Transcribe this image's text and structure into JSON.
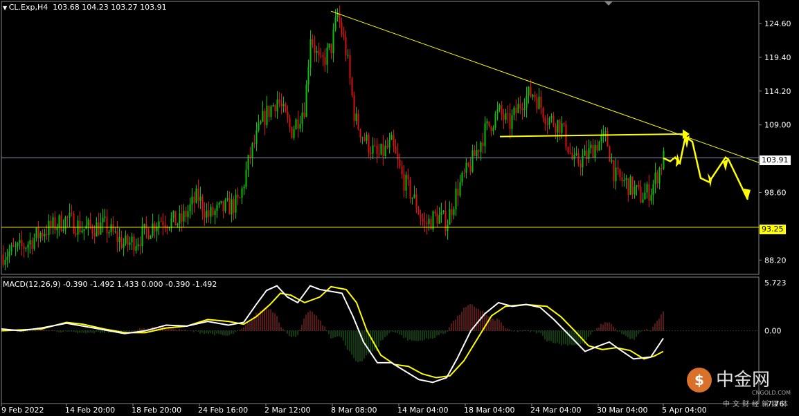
{
  "header": {
    "symbol": "CL.Exp,H4",
    "ohlc": "103.68 104.23 103.27 103.91",
    "macd_label": "MACD(12,26,9)",
    "macd_values": "-0.390 -1.492 1.433 0.000 -0.390 -1.492"
  },
  "price_axis": {
    "ticks": [
      "124.60",
      "119.40",
      "114.20",
      "109.00",
      "98.60",
      "88.20"
    ],
    "current_price": "103.91",
    "support_level": "93.25"
  },
  "macd_axis": {
    "ticks": [
      "5.723",
      "0.00",
      "-7.76"
    ]
  },
  "time_axis": {
    "ticks": [
      "9 Feb 2022",
      "14 Feb 20:00",
      "18 Feb 20:00",
      "24 Feb 16:00",
      "2 Mar 12:00",
      "8 Mar 08:00",
      "14 Mar 04:00",
      "18 Mar 04:00",
      "24 Mar 04:00",
      "30 Mar 04:00",
      "5 Apr 04:00"
    ]
  },
  "colors": {
    "background": "#000000",
    "bull": "#00c800",
    "bear": "#e01010",
    "trendline": "#ffff00",
    "macd_main": "#ffffff",
    "macd_signal": "#ffff00",
    "hist_pos": "#b03030",
    "hist_neg": "#1f7a1f",
    "current_price_line": "#8c97b0"
  },
  "watermark": {
    "brand": "中金网",
    "domain": "CNGOLD.COM",
    "tagline": "中文财经新媒体"
  },
  "chart_data": [
    {
      "type": "candlestick",
      "title": "CL.Exp,H4",
      "ylim": [
        86,
        128
      ],
      "current_price": 103.91,
      "horizontal_levels": [
        93.25,
        103.91
      ],
      "close_path_approx": [
        {
          "x": "9 Feb 2022",
          "close": 89.0
        },
        {
          "x": "14 Feb 20:00",
          "close": 94.0
        },
        {
          "x": "18 Feb 20:00",
          "close": 91.5
        },
        {
          "x": "24 Feb 16:00",
          "close": 96.0
        },
        {
          "x": "2 Mar 12:00",
          "close": 112.0
        },
        {
          "x": "8 Mar 08:00",
          "close": 122.0
        },
        {
          "x": "14 Mar 04:00",
          "close": 97.0
        },
        {
          "x": "18 Mar 04:00",
          "close": 105.0
        },
        {
          "x": "24 Mar 04:00",
          "close": 112.5
        },
        {
          "x": "30 Mar 04:00",
          "close": 101.0
        },
        {
          "x": "5 Apr 04:00",
          "close": 103.91
        }
      ],
      "annotations": [
        {
          "kind": "descending_trendline",
          "from": {
            "x": "8 Mar 08:00",
            "price": 126.5
          },
          "to": {
            "x": "5 Apr 04:00",
            "price": 104.0
          }
        },
        {
          "kind": "resistance_level",
          "price": 107.5,
          "from": "18 Mar 04:00",
          "to": "5 Apr 04:00"
        },
        {
          "kind": "support_level",
          "price": 93.25
        },
        {
          "kind": "projected_path",
          "points": [
            103.9,
            103.5,
            107.2,
            100.5,
            103.5,
            97.5
          ]
        }
      ]
    },
    {
      "type": "line",
      "title": "MACD(12,26,9)",
      "ylim": [
        -7.76,
        5.723
      ],
      "series_values_at_ticks": {
        "x": [
          "9 Feb 2022",
          "14 Feb 20:00",
          "18 Feb 20:00",
          "24 Feb 16:00",
          "2 Mar 12:00",
          "8 Mar 08:00",
          "14 Mar 04:00",
          "18 Mar 04:00",
          "24 Mar 04:00",
          "30 Mar 04:00",
          "5 Apr 04:00"
        ],
        "main": [
          0.2,
          0.8,
          0.1,
          0.5,
          3.5,
          4.0,
          -3.5,
          -1.5,
          2.6,
          -1.5,
          -0.39
        ],
        "signal": [
          0.1,
          0.7,
          0.0,
          0.4,
          2.0,
          3.2,
          -2.8,
          -2.5,
          2.2,
          -0.8,
          -1.492
        ]
      }
    }
  ]
}
